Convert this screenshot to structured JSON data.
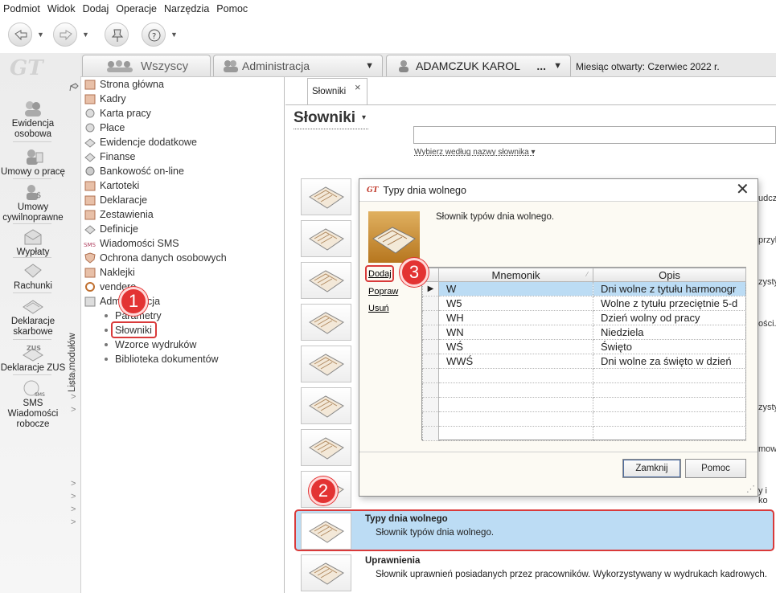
{
  "menu": [
    "Podmiot",
    "Widok",
    "Dodaj",
    "Operacje",
    "Narzędzia",
    "Pomoc"
  ],
  "toolbar": {
    "buttons": [
      "back-arrow-icon",
      "forward-arrow-icon",
      "pin-icon",
      "help-icon"
    ]
  },
  "logo_text": "GT",
  "modules": [
    {
      "label": "Ewidencja osobowa",
      "icon": "people-icon"
    },
    {
      "label": "Umowy o pracę",
      "icon": "contract-icon"
    },
    {
      "label": "Umowy cywilnoprawne",
      "icon": "contract-money-icon"
    },
    {
      "label": "Wypłaty",
      "icon": "envelope-icon"
    },
    {
      "label": "Rachunki",
      "icon": "invoice-icon"
    },
    {
      "label": "Deklaracje skarbowe",
      "icon": "tax-doc-icon"
    },
    {
      "label": "Deklaracje ZUS",
      "icon": "zus-icon"
    },
    {
      "label": "SMS Wiadomości robocze",
      "icon": "sms-icon"
    }
  ],
  "lista_modulow": "Lista modułów",
  "top_tabs": {
    "all": "Wszyscy",
    "admin": "Administracja",
    "employee": "ADAMCZUK KAROL",
    "employee_more": "...",
    "miesiac": "Miesiąc otwarty: Czerwiec 2022 r."
  },
  "nav": [
    "Strona główna",
    "Kadry",
    "Karta pracy",
    "Płace",
    "Ewidencje dodatkowe",
    "Finanse",
    "Bankowość on-line",
    "Kartoteki",
    "Deklaracje",
    "Zestawienia",
    "Definicje",
    "Wiadomości SMS",
    "Ochrona danych osobowych",
    "Naklejki",
    "vendero",
    "Administracja"
  ],
  "nav_sub": [
    "Parametry",
    "Słowniki",
    "Wzorce wydruków",
    "Biblioteka dokumentów"
  ],
  "badges": [
    "1",
    "2",
    "3"
  ],
  "doc_tab": "Słowniki",
  "doc_tab_close": "×",
  "heading": "Słowniki",
  "heading_caret": "▾",
  "search_hint": "Wybierz według nazwy słownika ▾",
  "partial_texts": [
    "udcza",
    "przykł",
    "zysty",
    "ości.",
    "zysty",
    "mow",
    "y i ko"
  ],
  "entries": [
    {
      "title": "Typy dnia wolnego",
      "desc": "Słownik typów dnia wolnego."
    },
    {
      "title": "Uprawnienia",
      "desc": "Słownik uprawnień posiadanych przez pracowników. Wykorzystywany w wydrukach kadrowych."
    }
  ],
  "dialog": {
    "title": "Typy dnia wolnego",
    "close": "✕",
    "description": "Słownik typów dnia wolnego.",
    "actions": [
      "Dodaj",
      "Popraw",
      "Usuń"
    ],
    "columns": [
      "Mnemonik",
      "Opis"
    ],
    "rows": [
      {
        "mnemonik": "W",
        "opis": "Dni wolne z tytułu harmonogr"
      },
      {
        "mnemonik": "W5",
        "opis": "Wolne z tytułu przeciętnie 5-d"
      },
      {
        "mnemonik": "WH",
        "opis": "Dzień wolny od pracy"
      },
      {
        "mnemonik": "WN",
        "opis": "Niedziela"
      },
      {
        "mnemonik": "WŚ",
        "opis": "Święto"
      },
      {
        "mnemonik": "WWŚ",
        "opis": "Dni wolne za święto w dzień"
      }
    ],
    "empty_rows": 5,
    "buttons": {
      "close": "Zamknij",
      "help": "Pomoc"
    }
  },
  "colors": {
    "selection": "#bcdcf4",
    "badge": "#e33333",
    "highlight_border": "#d93a3a"
  }
}
